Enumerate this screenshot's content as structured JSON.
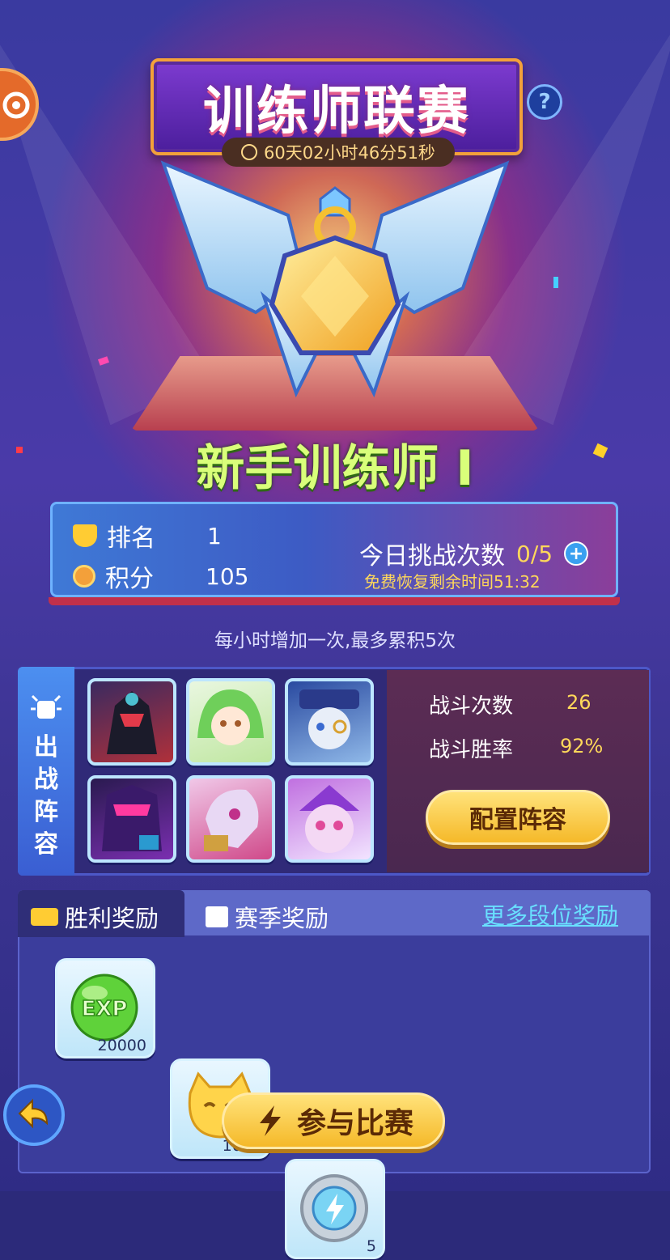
{
  "header": {
    "title": "训练师联赛",
    "countdown": "60天02小时46分51秒",
    "help_label": "?"
  },
  "rank": {
    "tier_name": "新手训练师 I",
    "ranking_label": "排名",
    "ranking_value": "1",
    "points_label": "积分",
    "points_value": "105"
  },
  "challenge": {
    "label": "今日挑战次数",
    "count": "0/5",
    "plus": "+",
    "recover_text": "免费恢复剩余时间51:32",
    "hint": "每小时增加一次,最多累积5次"
  },
  "lineup": {
    "side_label_chars": [
      "出",
      "战",
      "阵",
      "容"
    ],
    "heroes": [
      {
        "name": "hero-1",
        "color": "#b0303a"
      },
      {
        "name": "hero-2",
        "color": "#6fcf5a"
      },
      {
        "name": "hero-3",
        "color": "#3a6ad0"
      },
      {
        "name": "hero-4",
        "color": "#7a2fb0"
      },
      {
        "name": "hero-5",
        "color": "#d04a8a"
      },
      {
        "name": "hero-6",
        "color": "#c070e0"
      }
    ],
    "battles_label": "战斗次数",
    "battles_value": "26",
    "winrate_label": "战斗胜率",
    "winrate_value": "92%",
    "config_button": "配置阵容"
  },
  "rewards": {
    "tab_win": "胜利奖励",
    "tab_season": "赛季奖励",
    "more_link": "更多段位奖励",
    "items": [
      {
        "icon": "exp-orb-icon",
        "label": "EXP",
        "qty": "20000"
      },
      {
        "icon": "cat-coin-icon",
        "qty": "1000"
      },
      {
        "icon": "energy-badge-icon",
        "qty": "5"
      }
    ]
  },
  "footer": {
    "join_button": "参与比赛"
  }
}
